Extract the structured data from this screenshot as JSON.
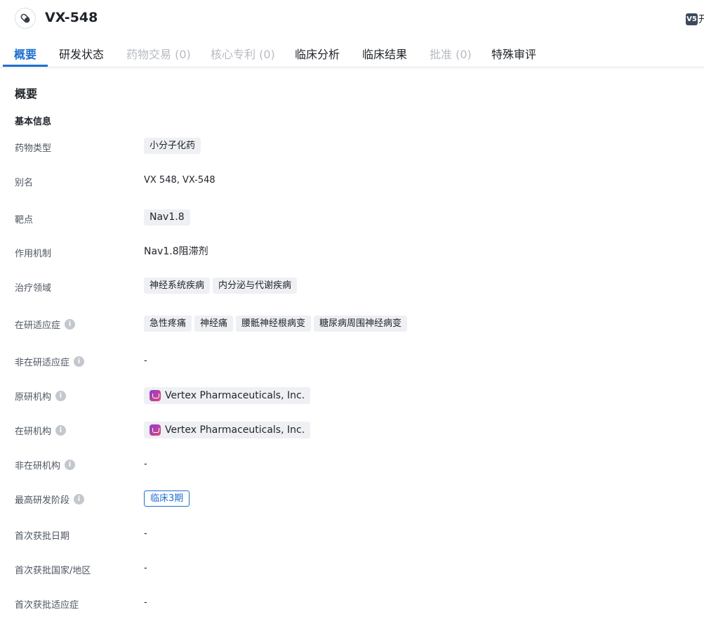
{
  "header": {
    "title": "VX-548",
    "corner_logo": "V5",
    "corner_text": "开"
  },
  "tabs": [
    {
      "label": "概要",
      "state": "active"
    },
    {
      "label": "研发状态",
      "state": "normal"
    },
    {
      "label": "药物交易 (0)",
      "state": "disabled"
    },
    {
      "label": "核心专利 (0)",
      "state": "disabled"
    },
    {
      "label": "临床分析",
      "state": "normal"
    },
    {
      "label": "临床结果",
      "state": "normal"
    },
    {
      "label": "批准 (0)",
      "state": "disabled"
    },
    {
      "label": "特殊审评",
      "state": "normal"
    }
  ],
  "overview": {
    "section_title": "概要",
    "basic_info_title": "基本信息",
    "rows": {
      "drug_type": {
        "label": "药物类型",
        "values": [
          "小分子化药"
        ]
      },
      "alias": {
        "label": "别名",
        "text": "VX 548,  VX-548"
      },
      "target": {
        "label": "靶点",
        "values": [
          "Nav1.8"
        ]
      },
      "mechanism": {
        "label": "作用机制",
        "text": "Nav1.8阻滞剂"
      },
      "therapeutic_area": {
        "label": "治疗领域",
        "values": [
          "神经系统疾病",
          "内分泌与代谢疾病"
        ]
      },
      "active_indications": {
        "label": "在研适应症",
        "values": [
          "急性疼痛",
          "神经痛",
          "腰骶神经根病变",
          "糖尿病周围神经病变"
        ]
      },
      "inactive_indications": {
        "label": "非在研适应症",
        "text": "-"
      },
      "originator": {
        "label": "原研机构",
        "org": "Vertex Pharmaceuticals, Inc."
      },
      "active_org": {
        "label": "在研机构",
        "org": "Vertex Pharmaceuticals, Inc."
      },
      "inactive_org": {
        "label": "非在研机构",
        "text": "-"
      },
      "highest_phase": {
        "label": "最高研发阶段",
        "tag": "临床3期"
      },
      "first_approval_date": {
        "label": "首次获批日期",
        "text": "-"
      },
      "first_approval_country": {
        "label": "首次获批国家/地区",
        "text": "-"
      },
      "first_approval_indication": {
        "label": "首次获批适应症",
        "text": "-"
      }
    }
  },
  "colors": {
    "accent": "#1f6fd1",
    "chip_bg": "#eef0f3",
    "disabled": "#b6bac2"
  },
  "icons": {
    "drug": "pill-icon",
    "info": "info-icon",
    "org_logo": "vertex-logo-icon"
  }
}
